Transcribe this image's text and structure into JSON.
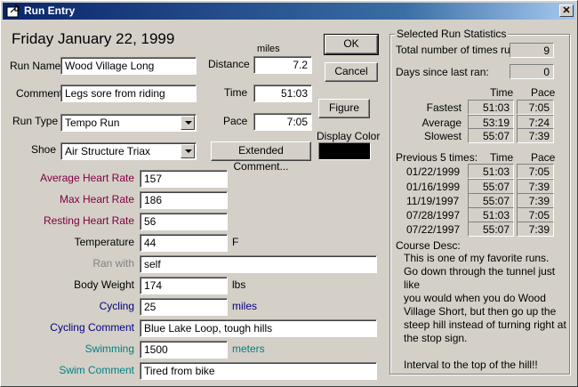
{
  "window": {
    "title": "Run Entry",
    "close_glyph": "✕"
  },
  "date_heading": "Friday January 22, 1999",
  "units_label": "miles",
  "form": {
    "run_name": {
      "label": "Run Name",
      "value": "Wood Village Long"
    },
    "comment": {
      "label": "Comment",
      "value": "Legs sore from riding"
    },
    "run_type": {
      "label": "Run Type",
      "value": "Tempo Run"
    },
    "shoe": {
      "label": "Shoe",
      "value": "Air Structure Triax"
    },
    "distance": {
      "label": "Distance",
      "value": "7.2"
    },
    "time": {
      "label": "Time",
      "value": "51:03"
    },
    "pace": {
      "label": "Pace",
      "value": "7:05"
    }
  },
  "buttons": {
    "ok": "OK",
    "cancel": "Cancel",
    "figure": "Figure",
    "extended_comment": "Extended Comment..."
  },
  "display_color": {
    "label": "Display Color",
    "value": "#000000"
  },
  "extra": {
    "avg_hr": {
      "label": "Average Heart Rate",
      "value": "157"
    },
    "max_hr": {
      "label": "Max Heart Rate",
      "value": "186"
    },
    "rest_hr": {
      "label": "Resting Heart Rate",
      "value": "56"
    },
    "temperature": {
      "label": "Temperature",
      "value": "44",
      "unit": "F"
    },
    "ran_with": {
      "label": "Ran with",
      "value": "self"
    },
    "body_weight": {
      "label": "Body Weight",
      "value": "174",
      "unit": "lbs"
    },
    "cycling": {
      "label": "Cycling",
      "value": "25",
      "unit": "miles"
    },
    "cycling_comment": {
      "label": "Cycling Comment",
      "value": "Blue Lake Loop, tough hills"
    },
    "swimming": {
      "label": "Swimming",
      "value": "1500",
      "unit": "meters"
    },
    "swim_comment": {
      "label": "Swim Comment",
      "value": "Tired from bike"
    }
  },
  "stats": {
    "title": "Selected Run Statistics",
    "total_label": "Total number of times run:",
    "total_value": "9",
    "days_label": "Days since last ran:",
    "days_value": "0",
    "time_header": "Time",
    "pace_header": "Pace",
    "rows": [
      {
        "label": "Fastest",
        "time": "51:03",
        "pace": "7:05"
      },
      {
        "label": "Average",
        "time": "53:19",
        "pace": "7:24"
      },
      {
        "label": "Slowest",
        "time": "55:07",
        "pace": "7:39"
      }
    ],
    "prev_label": "Previous 5 times:",
    "prev": [
      {
        "date": "01/22/1999",
        "time": "51:03",
        "pace": "7:05"
      },
      {
        "date": "01/16/1999",
        "time": "55:07",
        "pace": "7:39"
      },
      {
        "date": "11/19/1997",
        "time": "55:07",
        "pace": "7:39"
      },
      {
        "date": "07/28/1997",
        "time": "51:03",
        "pace": "7:05"
      },
      {
        "date": "07/22/1997",
        "time": "55:07",
        "pace": "7:39"
      }
    ],
    "course_desc_label": "Course Desc:",
    "course_desc_lines": [
      "This is one of my favorite runs.",
      "Go down through the tunnel just like",
      "you would when you do Wood",
      "Village Short, but then go up the",
      "steep hill instead of turning right at",
      "the stop sign.",
      "",
      "Interval to the top of the hill!!"
    ]
  }
}
